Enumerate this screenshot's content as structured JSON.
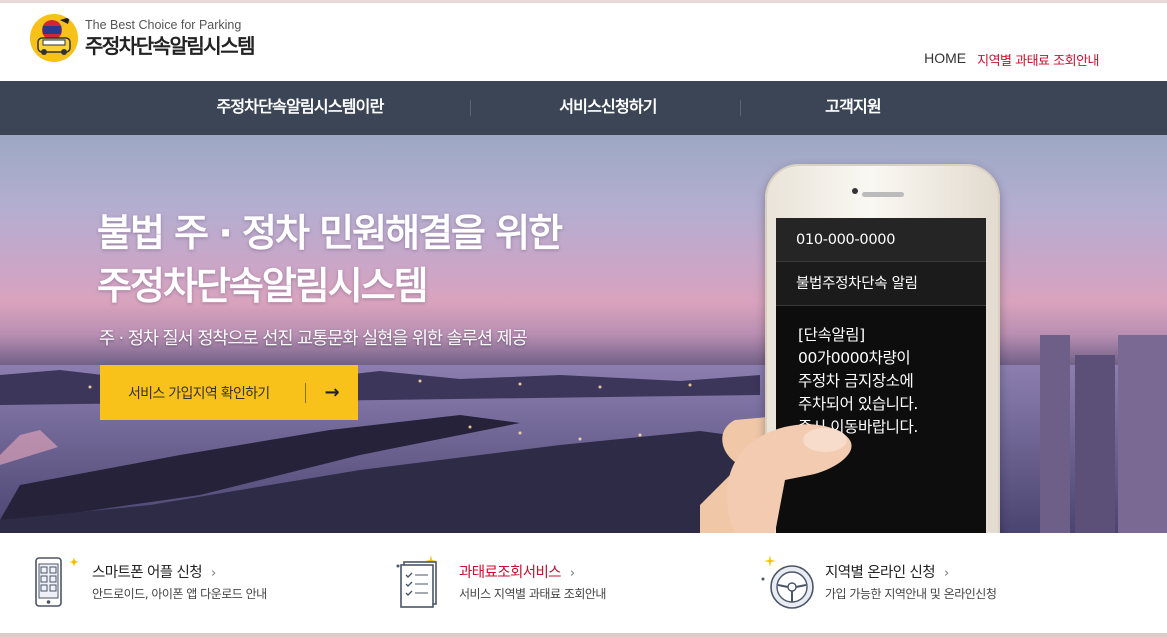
{
  "header": {
    "tagline": "The Best Choice for Parking",
    "title": "주정차단속알림시스템",
    "utility": {
      "home": "HOME",
      "fee_info": "지역별 과태료 조회안내"
    }
  },
  "gnb": {
    "items": [
      {
        "label": "주정차단속알림시스템이란"
      },
      {
        "label": "서비스신청하기"
      },
      {
        "label": "고객지원"
      }
    ]
  },
  "hero": {
    "headline_line1": "불법 주 · 정차 민원해결을 위한",
    "headline_line2": "주정차단속알림시스템",
    "subheadline": "주 · 정차 질서 정착으로 선진 교통문화 실현을 위한 솔루션 제공",
    "cta_label": "서비스 가입지역 확인하기",
    "cta_arrow": "→"
  },
  "phone": {
    "sender": "010-000-0000",
    "subject": "불법주정차단속 알림",
    "message_lines": [
      "[단속알림]",
      "00가0000차량이",
      "주정차 금지장소에",
      "주차되어 있습니다.",
      "즉시 이동바랍니다."
    ]
  },
  "services": [
    {
      "title": "스마트폰 어플 신청",
      "desc": "안드로이드, 아이폰 앱 다운로드 안내",
      "icon": "smartphone-app-icon"
    },
    {
      "title": "과태료조회서비스",
      "desc": "서비스 지역별 과태료 조회안내",
      "icon": "checklist-document-icon"
    },
    {
      "title": "지역별 온라인 신청",
      "desc": "가입 가능한 지역안내 및 온라인신청",
      "icon": "steering-wheel-icon"
    }
  ],
  "colors": {
    "brand_yellow": "#f8c21a",
    "gnb_bg": "#3b4556",
    "accent_red": "#c8102e"
  }
}
